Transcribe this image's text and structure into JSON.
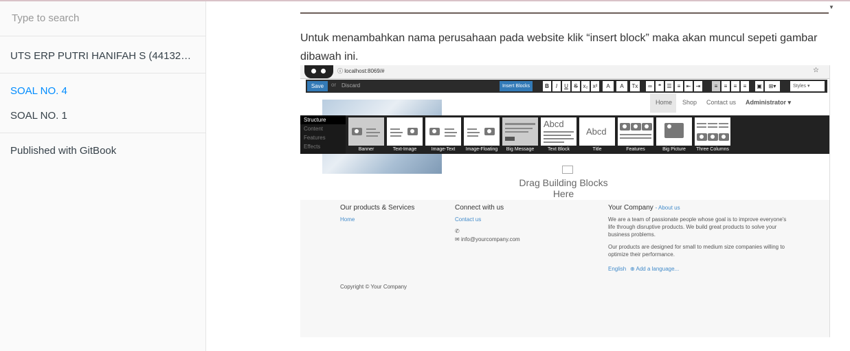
{
  "sidebar": {
    "search_placeholder": "Type to search",
    "book_title": "UTS ERP PUTRI HANIFAH S (4413210…",
    "items": [
      {
        "label": "SOAL NO. 4",
        "active": true
      },
      {
        "label": "SOAL NO. 1",
        "active": false
      }
    ],
    "published": "Published with GitBook"
  },
  "content": {
    "paragraph": "Untuk menambahkan nama perusahaan pada website klik “insert block” maka akan muncul sepeti gambar dibawah ini."
  },
  "screenshot": {
    "url": "localhost:8069/#",
    "editbar": {
      "save": "Save",
      "or": "or",
      "discard": "Discard",
      "insert_blocks": "Insert Blocks",
      "styles": "Styles"
    },
    "format_buttons": [
      "B",
      "I",
      "U",
      "S",
      "x₂",
      "x²",
      "A",
      "A",
      "Tx"
    ],
    "nav": {
      "home": "Home",
      "shop": "Shop",
      "contact": "Contact us",
      "admin": "Administrator ▾"
    },
    "block_menu": [
      "Structure",
      "Content",
      "Features",
      "Effects"
    ],
    "blocks": [
      "Banner",
      "Text-Image",
      "Image-Text",
      "Image-Floating",
      "Big Message",
      "Text Block",
      "Title",
      "Features",
      "Big Picture",
      "Three Columns"
    ],
    "drag_hint": "Drag Building Blocks Here",
    "footer": {
      "col1_title": "Our products & Services",
      "col1_link": "Home",
      "col2_title": "Connect with us",
      "col2_link": "Contact us",
      "col2_phone_icon": "✆",
      "col2_email": "info@yourcompany.com",
      "col3_title": "Your Company",
      "col3_about": "- About us",
      "col3_p1": "We are a team of passionate people whose goal is to improve everyone's life through disruptive products. We build great products to solve your business problems.",
      "col3_p2": "Our products are designed for small to medium size companies willing to optimize their performance.",
      "lang": "English",
      "add_lang": "Add a language...",
      "copyright": "Copyright © Your Company"
    }
  }
}
